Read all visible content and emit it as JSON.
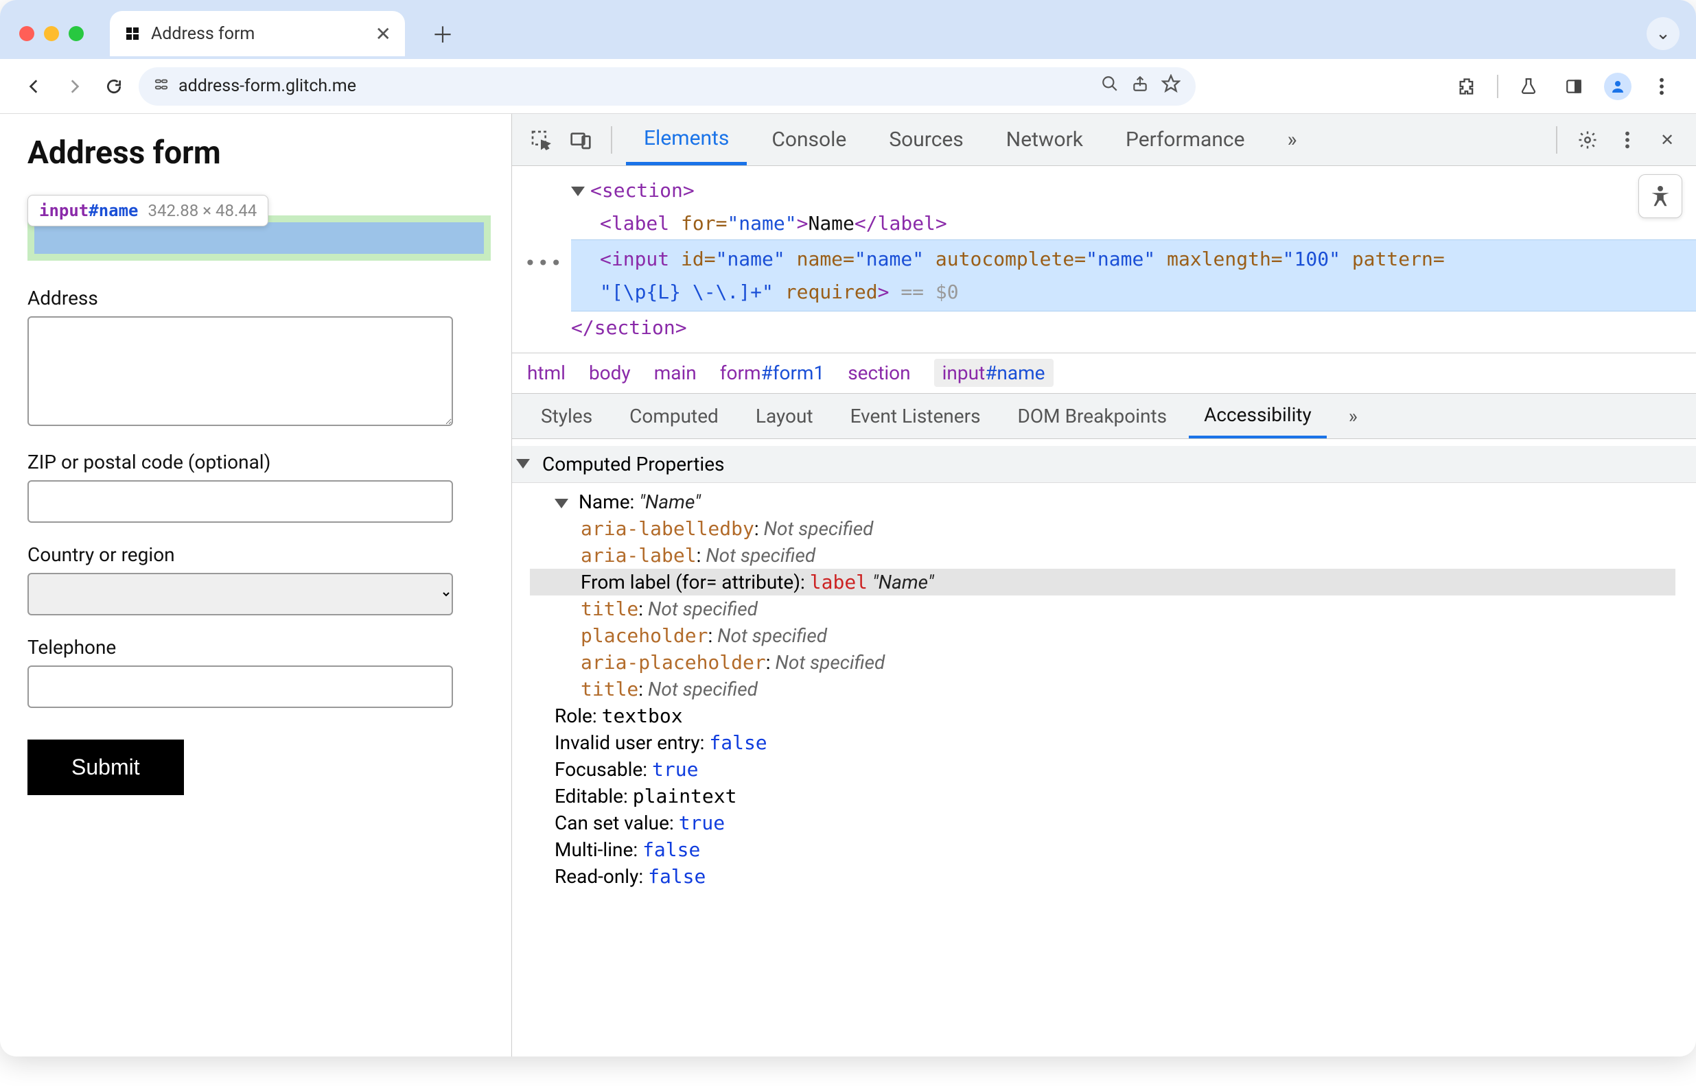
{
  "window": {
    "tab_title": "Address form",
    "url": "address-form.glitch.me"
  },
  "tooltip": {
    "tag": "input",
    "id": "#name",
    "dims": "342.88 × 48.44"
  },
  "form": {
    "heading": "Address form",
    "address_label": "Address",
    "zip_label": "ZIP or postal code (optional)",
    "country_label": "Country or region",
    "telephone_label": "Telephone",
    "submit_label": "Submit"
  },
  "devtools": {
    "tabs": [
      "Elements",
      "Console",
      "Sources",
      "Network",
      "Performance"
    ],
    "active_tab": "Elements",
    "dom": {
      "section_open": "<section>",
      "label_open": "<label",
      "label_for_attr": "for",
      "label_for_val": "\"name\"",
      "label_text": "Name",
      "label_close": "</label>",
      "input_tag": "<input",
      "input_attrs": [
        {
          "n": "id",
          "v": "\"name\""
        },
        {
          "n": "name",
          "v": "\"name\""
        },
        {
          "n": "autocomplete",
          "v": "\"name\""
        },
        {
          "n": "maxlength",
          "v": "\"100\""
        },
        {
          "n": "pattern",
          "v": ""
        }
      ],
      "pattern_val": "\"[\\p{L} \\-\\.]+\"",
      "required": "required",
      "eqsel": "== $0",
      "section_close": "</section>"
    },
    "breadcrumbs": [
      "html",
      "body",
      "main",
      "form#form1",
      "section",
      "input#name"
    ],
    "styles_tabs": [
      "Styles",
      "Computed",
      "Layout",
      "Event Listeners",
      "DOM Breakpoints",
      "Accessibility"
    ],
    "styles_active": "Accessibility",
    "a11y": {
      "header": "Computed Properties",
      "name_label": "Name:",
      "name_value": "\"Name\"",
      "rows": [
        {
          "prop": "aria-labelledby",
          "text": "Not specified"
        },
        {
          "prop": "aria-label",
          "text": "Not specified"
        }
      ],
      "from_label_prefix": "From label (for= attribute): ",
      "from_label_kw": "label",
      "from_label_val": "\"Name\"",
      "rows2": [
        {
          "prop": "title",
          "text": "Not specified"
        },
        {
          "prop": "placeholder",
          "text": "Not specified"
        },
        {
          "prop": "aria-placeholder",
          "text": "Not specified"
        },
        {
          "prop": "title",
          "text": "Not specified"
        }
      ],
      "props": [
        {
          "k": "Role:",
          "v": "textbox",
          "mono": true
        },
        {
          "k": "Invalid user entry:",
          "v": "false",
          "blue": true
        },
        {
          "k": "Focusable:",
          "v": "true",
          "blue": true
        },
        {
          "k": "Editable:",
          "v": "plaintext",
          "mono": true
        },
        {
          "k": "Can set value:",
          "v": "true",
          "blue": true
        },
        {
          "k": "Multi-line:",
          "v": "false",
          "blue": true
        },
        {
          "k": "Read-only:",
          "v": "false",
          "blue": true
        }
      ]
    }
  }
}
